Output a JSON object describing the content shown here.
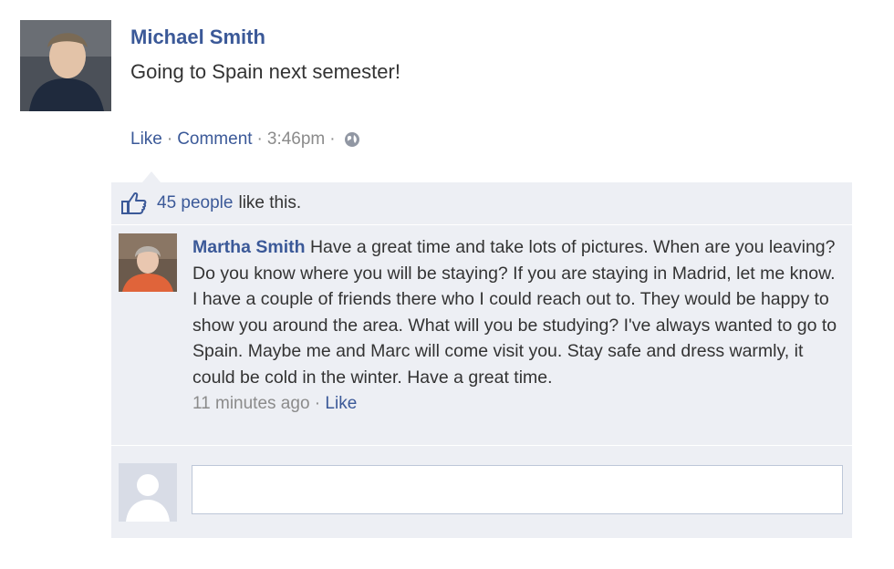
{
  "post": {
    "author": "Michael Smith",
    "text": "Going to Spain next semester!",
    "actions": {
      "like_label": "Like",
      "separator": "·",
      "comment_label": "Comment",
      "timestamp": "3:46pm",
      "privacy_icon": "globe-icon"
    }
  },
  "likes": {
    "icon": "thumbs-up-icon",
    "count_label": "45 people",
    "suffix": "like this."
  },
  "comment": {
    "author": "Martha Smith",
    "text": "Have a great time and take lots of pictures. When are you leaving? Do you know where you will be staying? If you are staying in Madrid, let me know. I have a couple of friends there who I could reach out to. They would be happy to show you around the area. What will you be studying? I've always wanted to go to Spain. Maybe me and Marc will come visit you. Stay safe and dress warmly, it could be cold in the winter. Have a great time.",
    "time": "11 minutes ago",
    "separator": "·",
    "like_label": "Like"
  },
  "reply": {
    "value": "",
    "placeholder": ""
  },
  "colors": {
    "link": "#3b5998",
    "meta_gray": "#8b8b8b",
    "comment_bg": "#edeff4"
  }
}
